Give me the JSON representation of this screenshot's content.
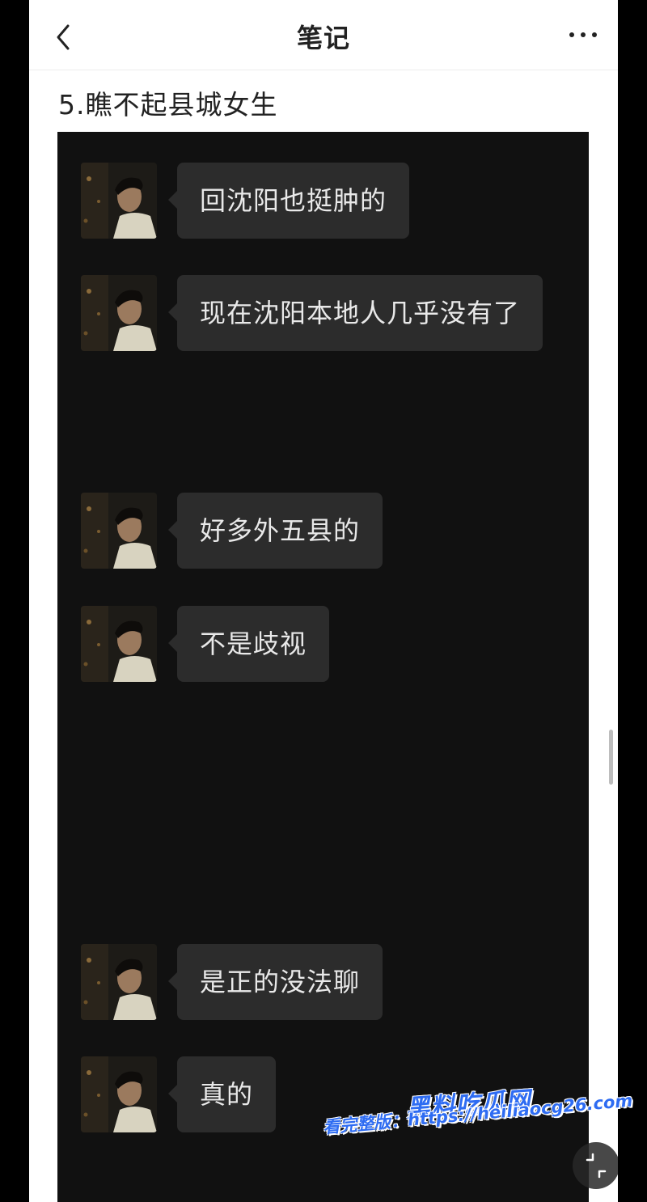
{
  "header": {
    "title": "笔记",
    "back_icon": "chevron-left-icon",
    "more_icon": "more-dots-icon"
  },
  "note": {
    "title": "5.瞧不起县城女生"
  },
  "chat": {
    "messages": [
      {
        "text": "回沈阳也挺肿的"
      },
      {
        "text": "现在沈阳本地人几乎没有了"
      },
      {
        "text": "好多外五县的"
      },
      {
        "text": "不是歧视"
      },
      {
        "text": "是正的没法聊"
      },
      {
        "text": "真的"
      }
    ]
  },
  "watermark": {
    "brand": "黑料吃瓜网",
    "url_line": "看完整版：https://heiliaocg26.com"
  },
  "colors": {
    "chat_background": "#111111",
    "bubble": "#2c2c2c",
    "watermark_blue": "#2e6cf2"
  }
}
